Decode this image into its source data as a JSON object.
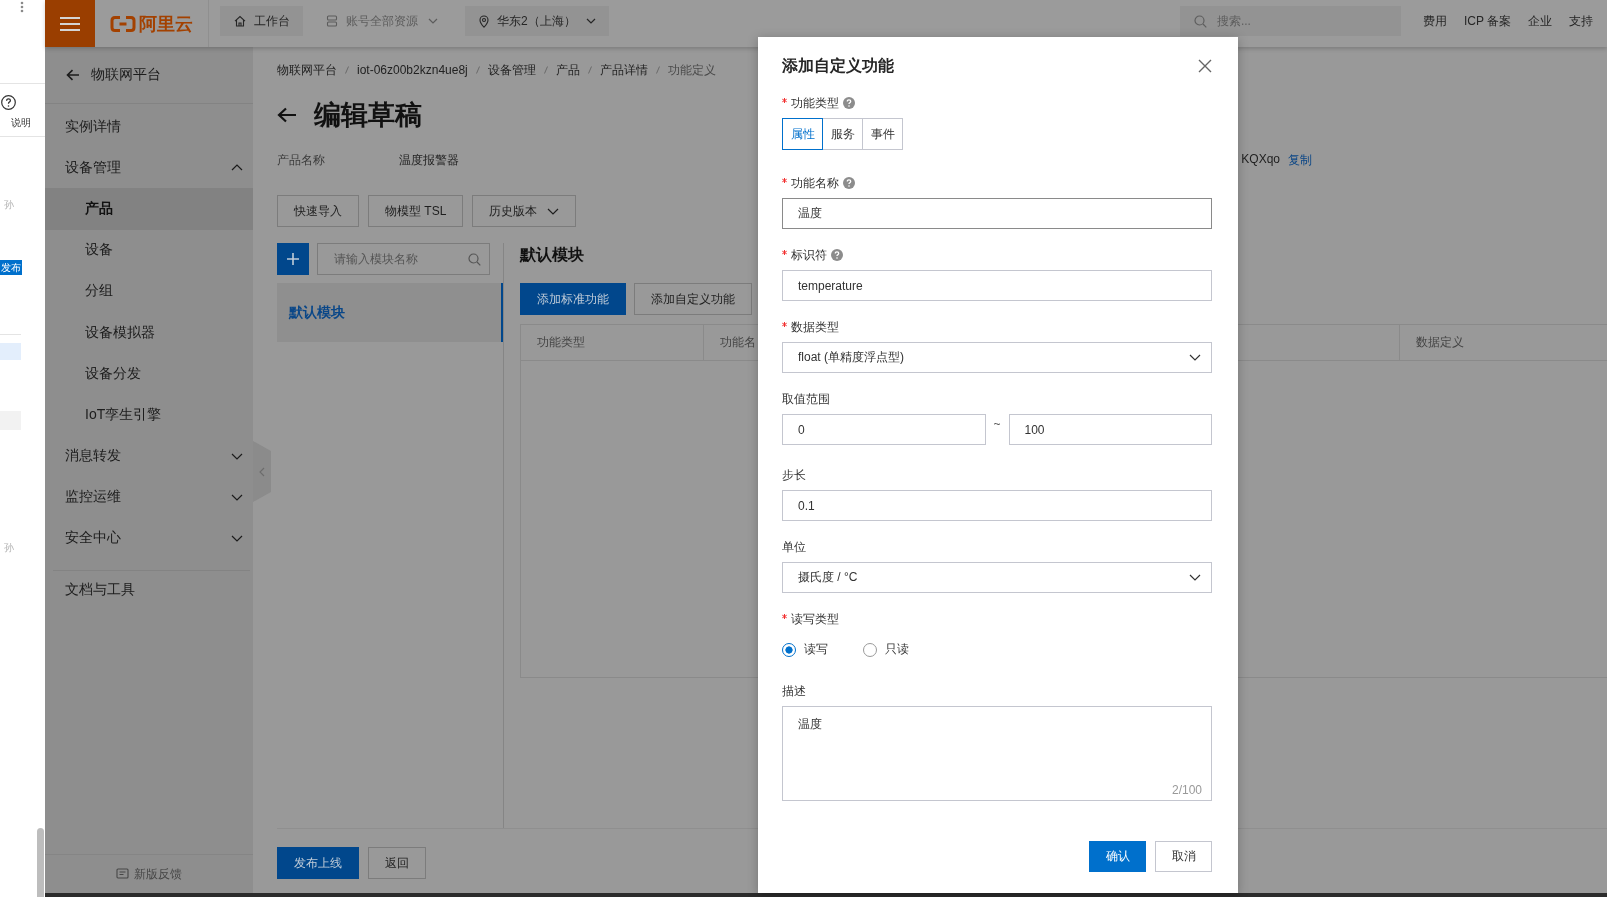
{
  "background_window": {
    "help_label": "说明",
    "badge": "发布",
    "snippets": [
      "孙",
      "孙"
    ]
  },
  "top_bar": {
    "logo": "阿里云",
    "nav": [
      {
        "kind": "home",
        "label": "工作台",
        "disabled": false
      },
      {
        "kind": "resources",
        "label": "账号全部资源",
        "disabled": true
      },
      {
        "kind": "region",
        "label": "华东2（上海）",
        "disabled": false
      }
    ],
    "search": {
      "placeholder": "搜索..."
    },
    "links": [
      "费用",
      "ICP 备案",
      "企业",
      "支持"
    ]
  },
  "sidebar": {
    "back": "物联网平台",
    "items": [
      {
        "kind": "link",
        "label": "实例详情",
        "selected": false
      },
      {
        "kind": "group",
        "label": "设备管理",
        "expanded": true,
        "children": [
          {
            "label": "产品",
            "selected": true
          },
          {
            "label": "设备",
            "selected": false
          },
          {
            "label": "分组",
            "selected": false
          },
          {
            "label": "设备模拟器",
            "selected": false
          },
          {
            "label": "设备分发",
            "selected": false
          },
          {
            "label": "IoT孪生引擎",
            "selected": false
          }
        ]
      },
      {
        "kind": "group",
        "label": "消息转发",
        "expanded": false
      },
      {
        "kind": "group",
        "label": "监控运维",
        "expanded": false
      },
      {
        "kind": "group",
        "label": "安全中心",
        "expanded": false
      }
    ],
    "tools": [
      {
        "label": "文档与工具",
        "selected": false
      }
    ],
    "feedback": "新版反馈"
  },
  "breadcrumb": [
    {
      "label": "物联网平台",
      "current": false
    },
    {
      "label": "iot-06z00b2kzn4ue8j",
      "current": false
    },
    {
      "label": "设备管理",
      "current": false
    },
    {
      "label": "产品",
      "current": false
    },
    {
      "label": "产品详情",
      "current": false
    },
    {
      "label": "功能定义",
      "current": true
    }
  ],
  "page": {
    "title": "编辑草稿",
    "product": {
      "label": "产品名称",
      "value": "温度报警器"
    },
    "product_key": {
      "value": "KQXqo",
      "action": "复制"
    },
    "toolbar": [
      {
        "kind": "button",
        "label": "快速导入"
      },
      {
        "kind": "button",
        "label": "物模型 TSL"
      },
      {
        "kind": "dropdown",
        "label": "历史版本"
      }
    ]
  },
  "modules": {
    "search": {
      "placeholder": "请输入模块名称"
    },
    "items": [
      {
        "label": "默认模块",
        "selected": true
      }
    ]
  },
  "module_panel": {
    "title": "默认模块",
    "actions": [
      {
        "kind": "primary",
        "label": "添加标准功能"
      },
      {
        "kind": "secondary",
        "label": "添加自定义功能"
      }
    ],
    "table": {
      "columns": [
        "功能类型",
        "功能名",
        "数据定义"
      ]
    }
  },
  "footer": {
    "actions": [
      {
        "kind": "primary",
        "label": "发布上线"
      },
      {
        "kind": "secondary",
        "label": "返回"
      }
    ]
  },
  "dialog": {
    "title": "添加自定义功能",
    "fields": [
      {
        "kind": "segmented",
        "label": "功能类型",
        "required": true,
        "help": true,
        "options": [
          {
            "label": "属性",
            "selected": true
          },
          {
            "label": "服务",
            "selected": false
          },
          {
            "label": "事件",
            "selected": false
          }
        ]
      },
      {
        "kind": "text",
        "label": "功能名称",
        "required": true,
        "help": true,
        "focused": true,
        "value": "温度"
      },
      {
        "kind": "text",
        "label": "标识符",
        "required": true,
        "help": true,
        "focused": false,
        "value": "temperature"
      },
      {
        "kind": "select",
        "label": "数据类型",
        "required": true,
        "help": false,
        "focused": false,
        "value": "float (单精度浮点型)"
      },
      {
        "kind": "range",
        "label": "取值范围",
        "required": false,
        "help": false,
        "focused": false,
        "min": "0",
        "separator": "~",
        "max": "100"
      },
      {
        "kind": "text",
        "label": "步长",
        "required": false,
        "help": false,
        "focused": false,
        "value": "0.1"
      },
      {
        "kind": "select",
        "label": "单位",
        "required": false,
        "help": false,
        "focused": false,
        "value": "摄氏度 / °C"
      },
      {
        "kind": "radio",
        "label": "读写类型",
        "required": true,
        "help": false,
        "options": [
          {
            "label": "读写",
            "selected": true
          },
          {
            "label": "只读",
            "selected": false
          }
        ]
      },
      {
        "kind": "textarea",
        "label": "描述",
        "required": false,
        "help": false,
        "focused": false,
        "value": "温度",
        "counter": "2/100"
      }
    ],
    "buttons": [
      {
        "kind": "primary",
        "label": "确认"
      },
      {
        "kind": "secondary",
        "label": "取消"
      }
    ]
  }
}
